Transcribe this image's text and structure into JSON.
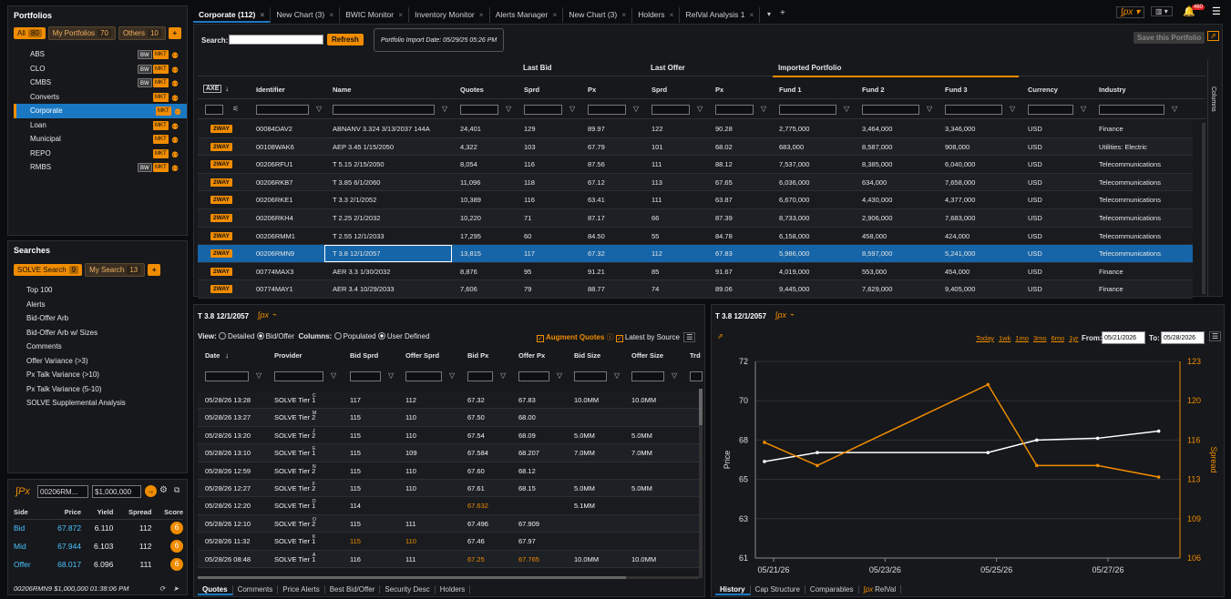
{
  "portfolios": {
    "title": "Portfolios",
    "chips": [
      {
        "label": "All",
        "count": "80"
      },
      {
        "label": "My Portfolios",
        "count": "70"
      },
      {
        "label": "Others",
        "count": "10"
      }
    ],
    "items": [
      {
        "label": "ABS",
        "bw": true
      },
      {
        "label": "CLO",
        "bw": true
      },
      {
        "label": "CMBS",
        "bw": true
      },
      {
        "label": "Converts",
        "bw": false
      },
      {
        "label": "Corporate",
        "bw": false,
        "selected": true
      },
      {
        "label": "Loan",
        "bw": false
      },
      {
        "label": "Municipal",
        "bw": false
      },
      {
        "label": "REPO",
        "bw": false
      },
      {
        "label": "RMBS",
        "bw": true
      }
    ],
    "bw": "BW",
    "mkt": "MKT"
  },
  "searches": {
    "title": "Searches",
    "chips": [
      {
        "label": "SOLVE Search",
        "count": "9"
      },
      {
        "label": "My Search",
        "count": "13"
      }
    ],
    "items": [
      "Top 100",
      "Alerts",
      "Bid-Offer Arb",
      "Bid-Offer Arb w/ Sizes",
      "Comments",
      "Offer Variance (>3)",
      "Px Talk Variance (>10)",
      "Px Talk Variance (5-10)",
      "SOLVE Supplemental Analysis"
    ]
  },
  "pricer": {
    "logo": "∫Px",
    "cusip": "00206RM...",
    "size": "$1,000,000",
    "headers": [
      "Side",
      "Price",
      "Yield",
      "Spread",
      "Score"
    ],
    "rows": [
      {
        "side": "Bid",
        "price": "67.872",
        "yield": "6.110",
        "spread": "112",
        "score": "6"
      },
      {
        "side": "Mid",
        "price": "67.944",
        "yield": "6.103",
        "spread": "112",
        "score": "6"
      },
      {
        "side": "Offer",
        "price": "68.017",
        "yield": "6.096",
        "spread": "111",
        "score": "6"
      }
    ],
    "footer": "00206RMN9  $1,000,000  01:38:06 PM"
  },
  "tabs": [
    "Corporate (112)",
    "New Chart (3)",
    "BWIC Monitor",
    "Inventory Monitor",
    "Alerts Manager",
    "New Chart (3)",
    "Holders",
    "RelVal Analysis 1"
  ],
  "toolbar": {
    "search_label": "Search:",
    "refresh": "Refresh",
    "import_date": "Portfolio Import Date: 05/29/25 05:26 PM",
    "save": "Save this Portfolio",
    "notif": "460"
  },
  "grid": {
    "groups": {
      "bid": "Last Bid",
      "offer": "Last Offer",
      "imported": "Imported Portfolio"
    },
    "axe": "AXE",
    "headers": [
      "Identifier",
      "Name",
      "Quotes",
      "Sprd",
      "Px",
      "Sprd",
      "Px",
      "Fund 1",
      "Fund 2",
      "Fund 3",
      "Currency",
      "Industry"
    ],
    "columns_label": "Columns",
    "rows": [
      [
        "2WAY",
        "00084DAV2",
        "ABNANV 3.324 3/13/2037 144A",
        "24,401",
        "129",
        "89.97",
        "122",
        "90.28",
        "2,775,000",
        "3,464,000",
        "3,346,000",
        "USD",
        "Finance"
      ],
      [
        "2WAY",
        "00108WAK6",
        "AEP 3.45 1/15/2050",
        "4,322",
        "103",
        "67.79",
        "101",
        "68.02",
        "683,000",
        "8,587,000",
        "908,000",
        "USD",
        "Utilities: Electric"
      ],
      [
        "2WAY",
        "00206RFU1",
        "T 5.15 2/15/2050",
        "8,054",
        "116",
        "87.56",
        "111",
        "88.12",
        "7,537,000",
        "8,385,000",
        "6,040,000",
        "USD",
        "Telecommunications"
      ],
      [
        "2WAY",
        "00206RKB7",
        "T 3.85 6/1/2060",
        "11,096",
        "118",
        "67.12",
        "113",
        "67.65",
        "6,036,000",
        "634,000",
        "7,658,000",
        "USD",
        "Telecommunications"
      ],
      [
        "2WAY",
        "00206RKE1",
        "T 3.3 2/1/2052",
        "10,389",
        "116",
        "63.41",
        "111",
        "63.87",
        "6,670,000",
        "4,430,000",
        "4,377,000",
        "USD",
        "Telecommunications"
      ],
      [
        "2WAY",
        "00206RKH4",
        "T 2.25 2/1/2032",
        "10,220",
        "71",
        "87.17",
        "66",
        "87.39",
        "8,733,000",
        "2,906,000",
        "7,683,000",
        "USD",
        "Telecommunications"
      ],
      [
        "2WAY",
        "00206RMM1",
        "T 2.55 12/1/2033",
        "17,295",
        "60",
        "84.50",
        "55",
        "84.78",
        "6,158,000",
        "458,000",
        "424,000",
        "USD",
        "Telecommunications"
      ],
      [
        "2WAY",
        "00206RMN9",
        "T 3.8 12/1/2057",
        "13,815",
        "117",
        "67.32",
        "112",
        "67.83",
        "5,986,000",
        "8,597,000",
        "5,241,000",
        "USD",
        "Telecommunications"
      ],
      [
        "2WAY",
        "00774MAX3",
        "AER 3.3 1/30/2032",
        "8,876",
        "95",
        "91.21",
        "85",
        "91.67",
        "4,019,000",
        "553,000",
        "454,000",
        "USD",
        "Finance"
      ],
      [
        "2WAY",
        "00774MAY1",
        "AER 3.4 10/29/2033",
        "7,606",
        "79",
        "88.77",
        "74",
        "89.06",
        "9,445,000",
        "7,629,000",
        "9,405,000",
        "USD",
        "Finance"
      ]
    ]
  },
  "quotes": {
    "title": "T 3.8 12/1/2057",
    "view_label": "View:",
    "detailed": "Detailed",
    "bidoffer": "Bid/Offer",
    "columns_label": "Columns:",
    "populated": "Populated",
    "userdef": "User Defined",
    "augment": "Augment Quotes",
    "latest": "Latest by Source",
    "headers": [
      "Date",
      "Provider",
      "Bid Sprd",
      "Offer Sprd",
      "Bid Px",
      "Offer Px",
      "Bid Size",
      "Offer Size",
      "Trd"
    ],
    "rows": [
      [
        "05/28/26 13:28",
        "SOLVE Tier 1",
        "C",
        "117",
        "112",
        "67.32",
        "67.83",
        "10.0MM",
        "10.0MM"
      ],
      [
        "05/28/26 13:27",
        "SOLVE Tier 2",
        "M",
        "115",
        "110",
        "67.50",
        "68.00",
        "",
        ""
      ],
      [
        "05/28/26 13:20",
        "SOLVE Tier 2",
        "J",
        "115",
        "110",
        "67.54",
        "68.09",
        "5.0MM",
        "5.0MM"
      ],
      [
        "05/28/26 13:10",
        "SOLVE Tier 1",
        "E",
        "115",
        "109",
        "67.584",
        "68.207",
        "7.0MM",
        "7.0MM"
      ],
      [
        "05/28/26 12:59",
        "SOLVE Tier 2",
        "N",
        "115",
        "110",
        "67.60",
        "68.12",
        "",
        ""
      ],
      [
        "05/28/26 12:27",
        "SOLVE Tier 2",
        "F",
        "115",
        "110",
        "67.61",
        "68.15",
        "5.0MM",
        "5.0MM"
      ],
      [
        "05/28/26 12:20",
        "SOLVE Tier 1",
        "D",
        "114",
        "",
        "67.632",
        "",
        "5.1MM",
        ""
      ],
      [
        "05/28/26 12:10",
        "SOLVE Tier 2",
        "O",
        "115",
        "111",
        "67.496",
        "67.909",
        "",
        ""
      ],
      [
        "05/28/26 11:32",
        "SOLVE Tier 1",
        "K",
        "115",
        "110",
        "67.46",
        "67.97",
        "",
        ""
      ],
      [
        "05/28/26 08:48",
        "SOLVE Tier 1",
        "A",
        "116",
        "111",
        "67.25",
        "67.765",
        "10.0MM",
        "10.0MM"
      ]
    ],
    "orange_cells": [
      [
        6,
        5
      ],
      [
        8,
        3
      ],
      [
        8,
        4
      ],
      [
        9,
        5
      ],
      [
        9,
        6
      ]
    ],
    "tabs": [
      "Quotes",
      "Comments",
      "Price Alerts",
      "Best Bid/Offer",
      "Security Desc",
      "Holders"
    ]
  },
  "chartpanel": {
    "title": "T 3.8 12/1/2057",
    "ranges": [
      "Today",
      "1wk",
      "1mo",
      "3mo",
      "6mo",
      "1yr"
    ],
    "from_label": "From:",
    "from": "05/21/2026",
    "to_label": "To:",
    "to": "05/28/2026",
    "tabs": [
      "History",
      "Cap Structure",
      "Comparables",
      "RelVal"
    ]
  },
  "chart_data": {
    "type": "line",
    "x": [
      "05/21/26",
      "05/22/26",
      "05/25/26",
      "05/26/26",
      "05/27/26",
      "05/28/26"
    ],
    "xticks": [
      "05/21/26",
      "05/23/26",
      "05/25/26",
      "05/27/26"
    ],
    "ylabel": "Price",
    "y2label": "Spread",
    "ylim": [
      61,
      72
    ],
    "y2lim": [
      106,
      123
    ],
    "yticks": [
      "61",
      "63",
      "65",
      "68",
      "70",
      "72"
    ],
    "y2ticks": [
      "106",
      "109",
      "113",
      "116",
      "120",
      "123"
    ],
    "series": [
      {
        "axis": "left",
        "color": "#ffffff",
        "values": [
          66.4,
          66.9,
          66.9,
          67.6,
          67.7,
          68.1
        ]
      },
      {
        "axis": "right",
        "color": "#f08c00",
        "values": [
          116,
          114,
          121,
          114,
          114,
          113
        ]
      }
    ]
  },
  "colors": {
    "accent": "#f08c00",
    "select": "#1a78c2"
  }
}
